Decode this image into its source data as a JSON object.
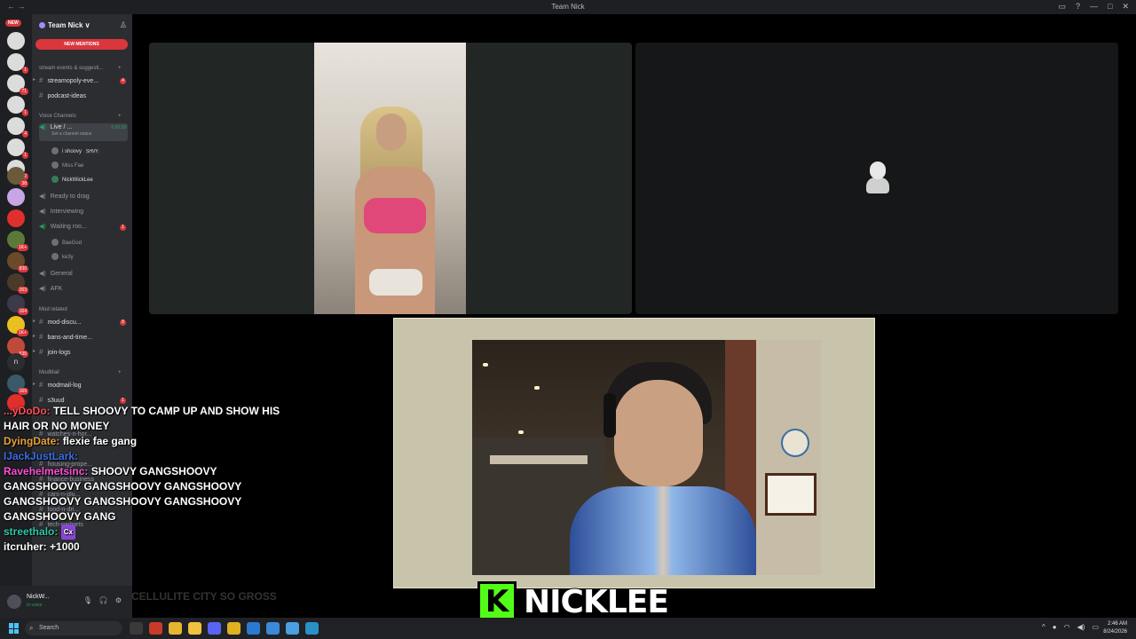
{
  "window": {
    "title": "Team Nick",
    "nav": "← →"
  },
  "server_rail": {
    "new_label": "NEW",
    "servers": [
      {
        "color": "#dcdcdc",
        "badge": ""
      },
      {
        "color": "#dcdcdc",
        "badge": "1"
      },
      {
        "color": "#dcdcdc",
        "badge": "71"
      },
      {
        "color": "#dcdcdc",
        "badge": "1"
      },
      {
        "color": "#dcdcdc",
        "badge": "4"
      },
      {
        "color": "#dcdcdc",
        "badge": "1"
      },
      {
        "color": "#dcdcdc",
        "badge": "2"
      },
      {
        "color": "#6b5a3a",
        "badge": "38"
      },
      {
        "color": "#c7a6e6",
        "badge": ""
      },
      {
        "color": "#e0302c",
        "badge": ""
      },
      {
        "color": "#5a7a3a",
        "badge": "1K+"
      },
      {
        "color": "#6a4a2a",
        "badge": "830"
      },
      {
        "color": "#4a3a2a",
        "badge": "263"
      },
      {
        "color": "#3a3a4a",
        "badge": "164"
      },
      {
        "color": "#e8c020",
        "badge": "1K+"
      },
      {
        "color": "#c04a3a",
        "badge": "535"
      },
      {
        "color": "#2a2a2a",
        "badge": ""
      },
      {
        "color": "#3a5a6a",
        "badge": "169"
      },
      {
        "color": "#e0302c",
        "badge": ""
      }
    ],
    "letter_server": "n"
  },
  "sidebar": {
    "server_name": "Team Nick ∨",
    "new_mentions": "NEW MENTIONS",
    "categories": {
      "stream_events": "stream events & suggesti...",
      "voice": "Voice Channels",
      "mod": "Mod related",
      "modmail": "ModMail"
    },
    "channels": {
      "streamopoly": "streamopoly-eve...",
      "podcast": "podcast-ideas",
      "live": "Live / ...",
      "live_time": "6:26:39",
      "live_status": "Set a channel status",
      "ready": "Ready to drag",
      "interviewing": "Interviewing",
      "waiting": "Waiting roo...",
      "general": "General",
      "afk": "AFK",
      "mod_discu": "mod-discu...",
      "bans": "bans-and-time...",
      "join_logs": "join-logs",
      "modmail_log": "modmail-log",
      "s3uud": "s3uud",
      "watches": "watches-n-hor...",
      "housing": "housing-prope...",
      "finance": "finance-business",
      "cars": "cars-n-plu...",
      "food": "food-n-dri...",
      "tech": "tech-gadgets"
    },
    "badges": {
      "streamopoly": "4",
      "waiting": "1",
      "mod_discu": "8",
      "s3uud": "1"
    },
    "voice_users": {
      "u1": "i shoovy",
      "u1_tag": "SHVY",
      "u2": "Miss Fae",
      "u3": "NickWickLee",
      "u4": "BaeGod",
      "u5": "ke3y"
    }
  },
  "user_panel": {
    "name": "NickW...",
    "status": "In voice"
  },
  "chat": [
    {
      "user": "...yDoDo:",
      "text": "TELL SHOOVY TO CAMP UP AND SHOW HIS HAIR OR NO MONEY",
      "color": "u1"
    },
    {
      "user": "DyingDate:",
      "text": "flexie fae gang",
      "color": "u2"
    },
    {
      "user": "IJackJustLark:",
      "text": "",
      "color": "u3"
    },
    {
      "user": "Ravehelmetsinc:",
      "text": "SHOOVY GANGSHOOVY GANGSHOOVY GANGSHOOVY GANGSHOOVY GANGSHOOVY GANGSHOOVY GANGSHOOVY GANGSHOOVY GANG",
      "color": "u4"
    },
    {
      "user": "streethalo:",
      "text": "",
      "badge": "Cx",
      "color": "u5"
    },
    {
      "user": "itcruher:",
      "text": "+1000",
      "color": "u6"
    }
  ],
  "faded_chat": "CELLULITE CITY SO GROSS",
  "stage": {
    "streamer_name": "NICKLEE",
    "platform_badge": "K"
  },
  "taskbar": {
    "search_placeholder": "Search",
    "time": "2:46 AM",
    "date": "8/24/2026"
  }
}
